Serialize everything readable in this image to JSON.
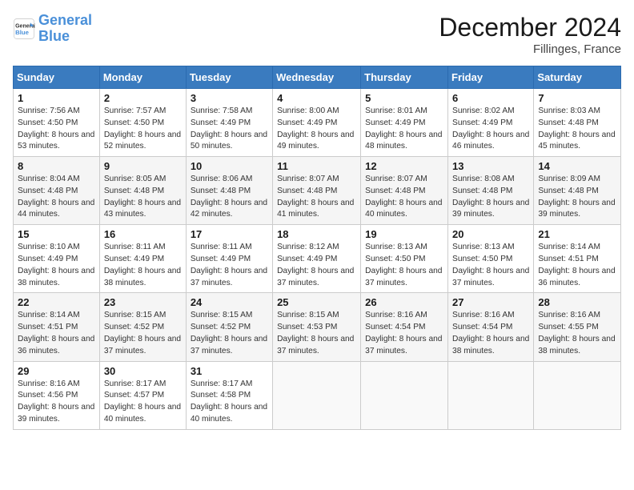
{
  "header": {
    "logo_line1": "General",
    "logo_line2": "Blue",
    "title": "December 2024",
    "subtitle": "Fillinges, France"
  },
  "calendar": {
    "columns": [
      "Sunday",
      "Monday",
      "Tuesday",
      "Wednesday",
      "Thursday",
      "Friday",
      "Saturday"
    ],
    "weeks": [
      [
        {
          "day": "1",
          "sunrise": "Sunrise: 7:56 AM",
          "sunset": "Sunset: 4:50 PM",
          "daylight": "Daylight: 8 hours and 53 minutes."
        },
        {
          "day": "2",
          "sunrise": "Sunrise: 7:57 AM",
          "sunset": "Sunset: 4:50 PM",
          "daylight": "Daylight: 8 hours and 52 minutes."
        },
        {
          "day": "3",
          "sunrise": "Sunrise: 7:58 AM",
          "sunset": "Sunset: 4:49 PM",
          "daylight": "Daylight: 8 hours and 50 minutes."
        },
        {
          "day": "4",
          "sunrise": "Sunrise: 8:00 AM",
          "sunset": "Sunset: 4:49 PM",
          "daylight": "Daylight: 8 hours and 49 minutes."
        },
        {
          "day": "5",
          "sunrise": "Sunrise: 8:01 AM",
          "sunset": "Sunset: 4:49 PM",
          "daylight": "Daylight: 8 hours and 48 minutes."
        },
        {
          "day": "6",
          "sunrise": "Sunrise: 8:02 AM",
          "sunset": "Sunset: 4:49 PM",
          "daylight": "Daylight: 8 hours and 46 minutes."
        },
        {
          "day": "7",
          "sunrise": "Sunrise: 8:03 AM",
          "sunset": "Sunset: 4:48 PM",
          "daylight": "Daylight: 8 hours and 45 minutes."
        }
      ],
      [
        {
          "day": "8",
          "sunrise": "Sunrise: 8:04 AM",
          "sunset": "Sunset: 4:48 PM",
          "daylight": "Daylight: 8 hours and 44 minutes."
        },
        {
          "day": "9",
          "sunrise": "Sunrise: 8:05 AM",
          "sunset": "Sunset: 4:48 PM",
          "daylight": "Daylight: 8 hours and 43 minutes."
        },
        {
          "day": "10",
          "sunrise": "Sunrise: 8:06 AM",
          "sunset": "Sunset: 4:48 PM",
          "daylight": "Daylight: 8 hours and 42 minutes."
        },
        {
          "day": "11",
          "sunrise": "Sunrise: 8:07 AM",
          "sunset": "Sunset: 4:48 PM",
          "daylight": "Daylight: 8 hours and 41 minutes."
        },
        {
          "day": "12",
          "sunrise": "Sunrise: 8:07 AM",
          "sunset": "Sunset: 4:48 PM",
          "daylight": "Daylight: 8 hours and 40 minutes."
        },
        {
          "day": "13",
          "sunrise": "Sunrise: 8:08 AM",
          "sunset": "Sunset: 4:48 PM",
          "daylight": "Daylight: 8 hours and 39 minutes."
        },
        {
          "day": "14",
          "sunrise": "Sunrise: 8:09 AM",
          "sunset": "Sunset: 4:48 PM",
          "daylight": "Daylight: 8 hours and 39 minutes."
        }
      ],
      [
        {
          "day": "15",
          "sunrise": "Sunrise: 8:10 AM",
          "sunset": "Sunset: 4:49 PM",
          "daylight": "Daylight: 8 hours and 38 minutes."
        },
        {
          "day": "16",
          "sunrise": "Sunrise: 8:11 AM",
          "sunset": "Sunset: 4:49 PM",
          "daylight": "Daylight: 8 hours and 38 minutes."
        },
        {
          "day": "17",
          "sunrise": "Sunrise: 8:11 AM",
          "sunset": "Sunset: 4:49 PM",
          "daylight": "Daylight: 8 hours and 37 minutes."
        },
        {
          "day": "18",
          "sunrise": "Sunrise: 8:12 AM",
          "sunset": "Sunset: 4:49 PM",
          "daylight": "Daylight: 8 hours and 37 minutes."
        },
        {
          "day": "19",
          "sunrise": "Sunrise: 8:13 AM",
          "sunset": "Sunset: 4:50 PM",
          "daylight": "Daylight: 8 hours and 37 minutes."
        },
        {
          "day": "20",
          "sunrise": "Sunrise: 8:13 AM",
          "sunset": "Sunset: 4:50 PM",
          "daylight": "Daylight: 8 hours and 37 minutes."
        },
        {
          "day": "21",
          "sunrise": "Sunrise: 8:14 AM",
          "sunset": "Sunset: 4:51 PM",
          "daylight": "Daylight: 8 hours and 36 minutes."
        }
      ],
      [
        {
          "day": "22",
          "sunrise": "Sunrise: 8:14 AM",
          "sunset": "Sunset: 4:51 PM",
          "daylight": "Daylight: 8 hours and 36 minutes."
        },
        {
          "day": "23",
          "sunrise": "Sunrise: 8:15 AM",
          "sunset": "Sunset: 4:52 PM",
          "daylight": "Daylight: 8 hours and 37 minutes."
        },
        {
          "day": "24",
          "sunrise": "Sunrise: 8:15 AM",
          "sunset": "Sunset: 4:52 PM",
          "daylight": "Daylight: 8 hours and 37 minutes."
        },
        {
          "day": "25",
          "sunrise": "Sunrise: 8:15 AM",
          "sunset": "Sunset: 4:53 PM",
          "daylight": "Daylight: 8 hours and 37 minutes."
        },
        {
          "day": "26",
          "sunrise": "Sunrise: 8:16 AM",
          "sunset": "Sunset: 4:54 PM",
          "daylight": "Daylight: 8 hours and 37 minutes."
        },
        {
          "day": "27",
          "sunrise": "Sunrise: 8:16 AM",
          "sunset": "Sunset: 4:54 PM",
          "daylight": "Daylight: 8 hours and 38 minutes."
        },
        {
          "day": "28",
          "sunrise": "Sunrise: 8:16 AM",
          "sunset": "Sunset: 4:55 PM",
          "daylight": "Daylight: 8 hours and 38 minutes."
        }
      ],
      [
        {
          "day": "29",
          "sunrise": "Sunrise: 8:16 AM",
          "sunset": "Sunset: 4:56 PM",
          "daylight": "Daylight: 8 hours and 39 minutes."
        },
        {
          "day": "30",
          "sunrise": "Sunrise: 8:17 AM",
          "sunset": "Sunset: 4:57 PM",
          "daylight": "Daylight: 8 hours and 40 minutes."
        },
        {
          "day": "31",
          "sunrise": "Sunrise: 8:17 AM",
          "sunset": "Sunset: 4:58 PM",
          "daylight": "Daylight: 8 hours and 40 minutes."
        },
        null,
        null,
        null,
        null
      ]
    ]
  }
}
